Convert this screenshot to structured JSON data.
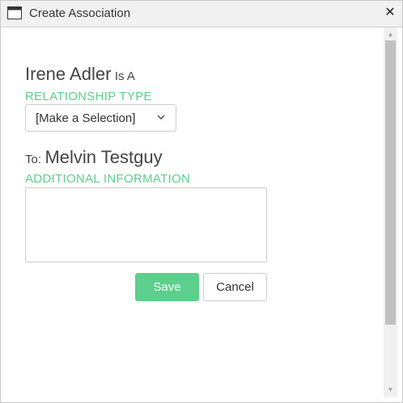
{
  "dialog": {
    "title": "Create Association",
    "close_label": "✕"
  },
  "form": {
    "source_name": "Irene Adler",
    "is_a_text": "Is A",
    "relationship_label": "RELATIONSHIP TYPE",
    "relationship_selected": "[Make a Selection]",
    "to_text": "To:",
    "target_name": "Melvin Testguy",
    "additional_label": "ADDITIONAL INFORMATION",
    "additional_value": ""
  },
  "buttons": {
    "save_label": "Save",
    "cancel_label": "Cancel"
  },
  "colors": {
    "accent": "#5ccf8d",
    "titlebar": "#f1f1f1",
    "scroll_thumb": "#c1c1c1"
  },
  "icons": {
    "window": "window-icon",
    "close": "close-icon",
    "dropdown": "chevron-down-icon",
    "scroll_up": "scroll-up-arrow-icon",
    "scroll_down": "scroll-down-arrow-icon"
  }
}
